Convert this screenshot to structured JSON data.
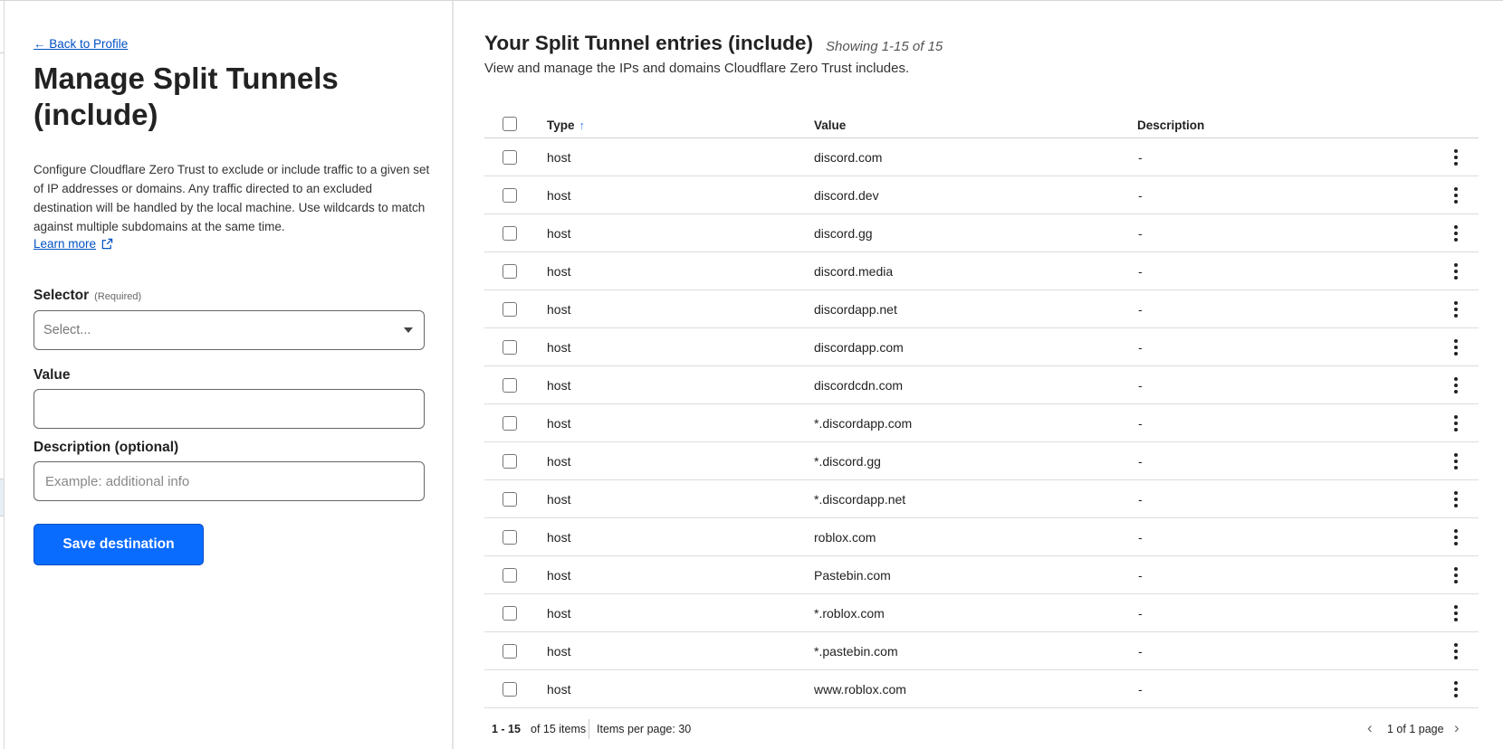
{
  "left": {
    "back_link": "← Back to Profile",
    "title": "Manage Split Tunnels (include)",
    "intro": "Configure Cloudflare Zero Trust to exclude or include traffic to a given set of IP addresses or domains. Any traffic directed to an excluded destination will be handled by the local machine. Use wildcards to match against multiple subdomains at the same time.",
    "learn_more": "Learn more",
    "selector": {
      "label": "Selector",
      "required": "(Required)",
      "placeholder": "Select..."
    },
    "value": {
      "label": "Value",
      "value": ""
    },
    "description": {
      "label": "Description (optional)",
      "placeholder": "Example: additional info"
    },
    "save_label": "Save destination"
  },
  "right": {
    "title": "Your Split Tunnel entries (include)",
    "count": "Showing 1-15 of 15",
    "subtitle": "View and manage the IPs and domains Cloudflare Zero Trust includes.",
    "columns": {
      "type": "Type",
      "value": "Value",
      "description": "Description"
    },
    "sort_icon": "↑",
    "rows": [
      {
        "type": "host",
        "value": "discord.com",
        "description": "-"
      },
      {
        "type": "host",
        "value": "discord.dev",
        "description": "-"
      },
      {
        "type": "host",
        "value": "discord.gg",
        "description": "-"
      },
      {
        "type": "host",
        "value": "discord.media",
        "description": "-"
      },
      {
        "type": "host",
        "value": "discordapp.net",
        "description": "-"
      },
      {
        "type": "host",
        "value": "discordapp.com",
        "description": "-"
      },
      {
        "type": "host",
        "value": "discordcdn.com",
        "description": "-"
      },
      {
        "type": "host",
        "value": "*.discordapp.com",
        "description": "-"
      },
      {
        "type": "host",
        "value": "*.discord.gg",
        "description": "-"
      },
      {
        "type": "host",
        "value": "*.discordapp.net",
        "description": "-"
      },
      {
        "type": "host",
        "value": "roblox.com",
        "description": "-"
      },
      {
        "type": "host",
        "value": "Pastebin.com",
        "description": "-"
      },
      {
        "type": "host",
        "value": "*.roblox.com",
        "description": "-"
      },
      {
        "type": "host",
        "value": "*.pastebin.com",
        "description": "-"
      },
      {
        "type": "host",
        "value": "www.roblox.com",
        "description": "-"
      }
    ],
    "pagination": {
      "range": "1 - 15",
      "of_items": "of 15 items",
      "per_page": "Items per page: 30",
      "pages": "1 of 1 page",
      "prev_icon": "‹",
      "next_icon": "›"
    }
  },
  "colors": {
    "link": "#0051c3",
    "primary_button": "#0a6cff",
    "sort_icon": "#3b82f6"
  }
}
